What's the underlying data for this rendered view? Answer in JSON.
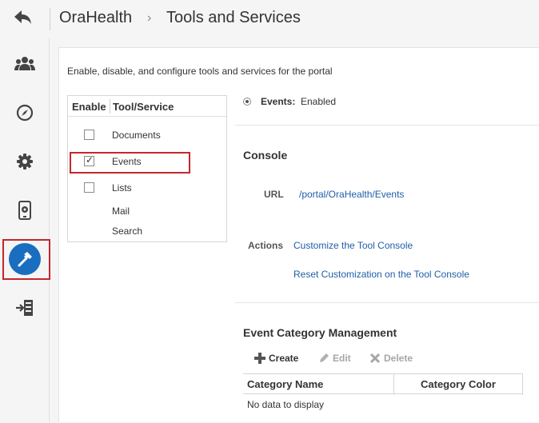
{
  "header": {
    "app_name": "OraHealth",
    "separator": "›",
    "page_title": "Tools and Services"
  },
  "sidebar": {
    "items": [
      {
        "icon": "users-icon"
      },
      {
        "icon": "compass-icon"
      },
      {
        "icon": "gear-icon"
      },
      {
        "icon": "device-settings-icon"
      },
      {
        "icon": "hammer-icon",
        "selected": true
      },
      {
        "icon": "export-icon"
      }
    ]
  },
  "main": {
    "description": "Enable, disable, and configure tools and services for the portal",
    "tool_table": {
      "col_enable": "Enable",
      "col_tool": "Tool/Service",
      "rows": [
        {
          "label": "Documents",
          "checked": false,
          "has_checkbox": true
        },
        {
          "label": "Events",
          "checked": true,
          "has_checkbox": true
        },
        {
          "label": "Lists",
          "checked": false,
          "has_checkbox": true
        },
        {
          "label": "Mail",
          "has_checkbox": false
        },
        {
          "label": "Search",
          "has_checkbox": false
        }
      ]
    },
    "detail": {
      "status_label": "Events:",
      "status_value": "Enabled",
      "console_title": "Console",
      "url_label": "URL",
      "url_value": "/portal/OraHealth/Events",
      "actions_label": "Actions",
      "action_customize": "Customize the Tool Console",
      "action_reset": "Reset Customization on the Tool Console",
      "ecm_title": "Event Category Management",
      "toolbar": {
        "create": "Create",
        "edit": "Edit",
        "delete": "Delete"
      },
      "table": {
        "col_name": "Category Name",
        "col_color": "Category Color",
        "empty": "No data to display"
      }
    }
  },
  "colors": {
    "accent": "#1a6ec0",
    "highlight": "#c6262e",
    "link": "#1f5ea8"
  }
}
